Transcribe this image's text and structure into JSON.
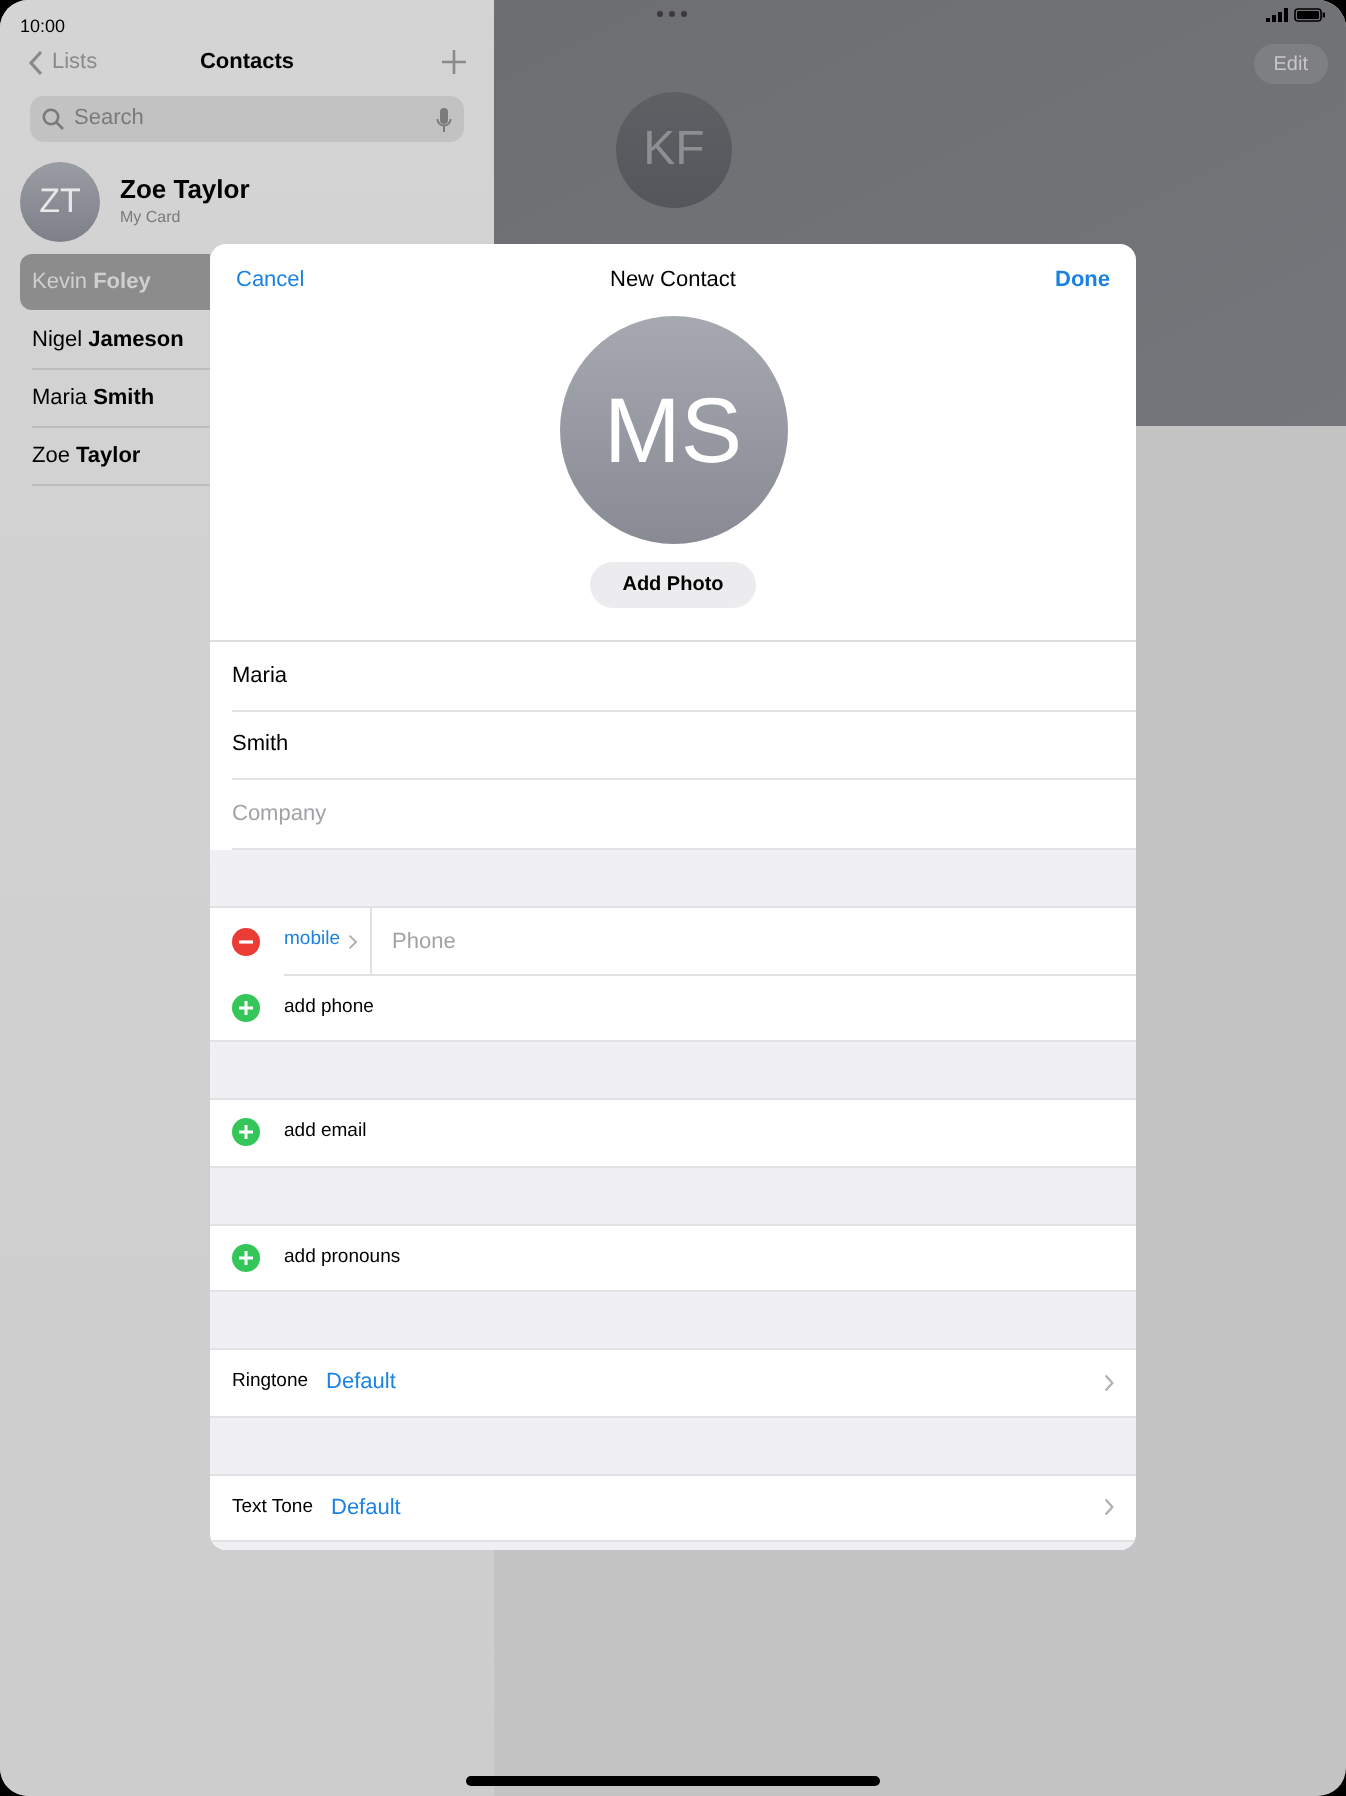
{
  "status_bar": {
    "time": "10:00"
  },
  "sidebar": {
    "back": "Lists",
    "title": "Contacts",
    "search": {
      "placeholder": "Search"
    },
    "my_card": {
      "initials": "ZT",
      "name": "Zoe Taylor",
      "subtitle": "My Card"
    },
    "contacts": [
      {
        "name": "Kevin **Foley**",
        "selected": true
      },
      {
        "name": "Nigel **Jameson**",
        "selected": false
      },
      {
        "name": "Maria **Smith**",
        "selected": false
      },
      {
        "name": "Zoe **Taylor**",
        "selected": false
      }
    ]
  },
  "detail": {
    "initials": "KF",
    "edit": "Edit"
  },
  "modal": {
    "cancel": "Cancel",
    "title": "New Contact",
    "done": "Done",
    "initials": "MS",
    "add_photo": "Add Photo",
    "fields": [
      {
        "value": "Maria"
      },
      {
        "value": "Smith"
      },
      {
        "placeholder": "Company"
      }
    ],
    "sections": [
      [
        {
          "kind": "phone",
          "label": "mobile",
          "placeholder": "Phone"
        },
        {
          "kind": "add",
          "label": "add phone"
        }
      ],
      [
        {
          "kind": "add",
          "label": "add email"
        }
      ],
      [
        {
          "kind": "add",
          "label": "add pronouns"
        }
      ],
      [
        {
          "kind": "setting",
          "label": "Ringtone",
          "value": "Default"
        }
      ],
      [
        {
          "kind": "setting",
          "label": "Text Tone",
          "value": "Default"
        }
      ]
    ]
  }
}
